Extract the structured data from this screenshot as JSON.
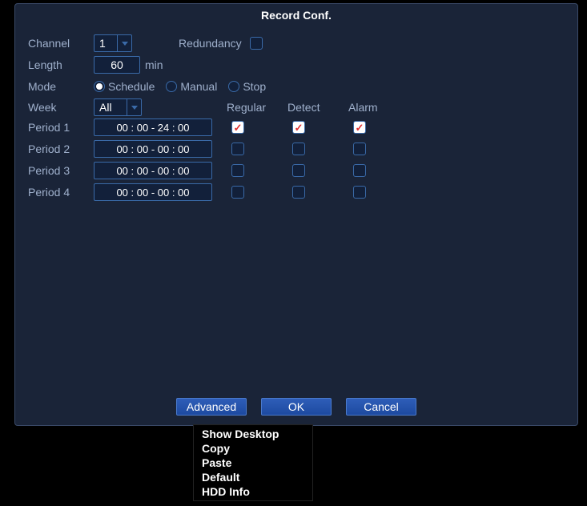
{
  "title": "Record Conf.",
  "labels": {
    "channel": "Channel",
    "length": "Length",
    "mode": "Mode",
    "week": "Week",
    "redundancy": "Redundancy",
    "min": "min"
  },
  "channel_value": "1",
  "length_value": "60",
  "week_value": "All",
  "modes": {
    "schedule": "Schedule",
    "manual": "Manual",
    "stop": "Stop"
  },
  "cols": {
    "regular": "Regular",
    "detect": "Detect",
    "alarm": "Alarm"
  },
  "periods": [
    {
      "label": "Period 1",
      "time": "00 : 00    -    24 : 00"
    },
    {
      "label": "Period 2",
      "time": "00 : 00    -    00 : 00"
    },
    {
      "label": "Period 3",
      "time": "00 : 00    -    00 : 00"
    },
    {
      "label": "Period 4",
      "time": "00 : 00    -    00 : 00"
    }
  ],
  "buttons": {
    "advanced": "Advanced",
    "ok": "OK",
    "cancel": "Cancel"
  },
  "menu": {
    "show_desktop": "Show Desktop",
    "copy": "Copy",
    "paste": "Paste",
    "default": "Default",
    "hdd_info": "HDD Info"
  }
}
